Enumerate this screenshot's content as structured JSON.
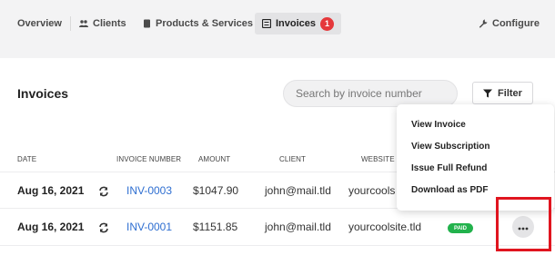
{
  "nav": {
    "overview": "Overview",
    "clients": "Clients",
    "products": "Products & Services",
    "invoices": "Invoices",
    "invoices_badge": "1",
    "configure": "Configure"
  },
  "page": {
    "title": "Invoices"
  },
  "search": {
    "placeholder": "Search by invoice number"
  },
  "filter": {
    "label": "Filter"
  },
  "table": {
    "headers": {
      "date": "DATE",
      "invoice_number": "INVOICE NUMBER",
      "amount": "AMOUNT",
      "client": "CLIENT",
      "website": "WEBSITE"
    },
    "rows": [
      {
        "date": "Aug 16, 2021",
        "invoice": "INV-0003",
        "amount": "$1047.90",
        "client": "john@mail.tld",
        "website": "yourcools"
      },
      {
        "date": "Aug 16, 2021",
        "invoice": "INV-0001",
        "amount": "$1151.85",
        "client": "john@mail.tld",
        "website": "yourcoolsite.tld",
        "status": "PAID"
      }
    ]
  },
  "menu": {
    "items": [
      "View Invoice",
      "View Subscription",
      "Issue Full Refund",
      "Download as PDF"
    ]
  },
  "colors": {
    "accent": "#2f6fd1",
    "badge": "#e5383b",
    "paid": "#22b24c",
    "highlight": "#e0151f"
  }
}
